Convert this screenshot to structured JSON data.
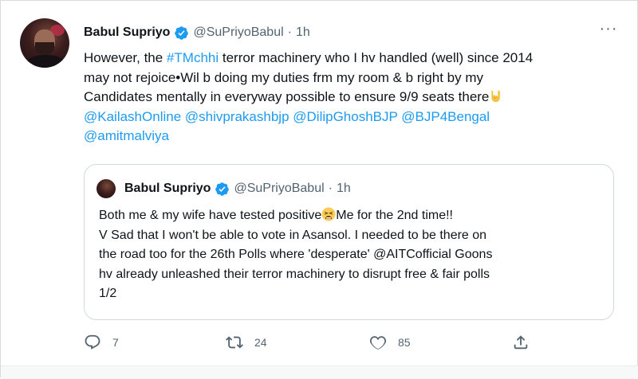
{
  "tweet": {
    "author_name": "Babul Supriyo",
    "handle": "@SuPriyoBabul",
    "separator": "·",
    "time": "1h",
    "more_label": "···",
    "lines": [
      [
        "However, the ",
        "#TMchhi",
        " terror machinery who I hv handled (well) since 2014"
      ],
      "may not rejoice•Wil b doing my duties frm my room & b right by my",
      "Candidates mentally in everyway possible to ensure 9/9 seats there",
      "@KailashOnline @shivprakashbjp @DilipGhoshBJP @BJP4Bengal",
      "@amitmalviya"
    ]
  },
  "quoted": {
    "author_name": "Babul Supriyo",
    "handle": "@SuPriyoBabul",
    "separator": "·",
    "time": "1h",
    "lines": [
      [
        "Both me & my wife have tested positive",
        "Me for the 2nd time!!"
      ],
      "V Sad that I won't be able to vote in Asansol. I needed to be there on",
      [
        "the road too for the 26th Polls where 'desperate' ",
        "@AITCofficial",
        " Goons"
      ],
      "hv already unleashed their terror machinery to disrupt free & fair polls",
      "1/2"
    ]
  },
  "actions": {
    "reply_count": "7",
    "retweet_count": "24",
    "like_count": "85"
  },
  "icons": {
    "verified": "verified-badge-icon",
    "reply": "reply-icon",
    "retweet": "retweet-icon",
    "like": "heart-icon",
    "share": "share-icon",
    "rock_emoji": "sign-of-horns-emoji-icon",
    "tired_emoji": "tired-face-emoji-icon"
  },
  "colors": {
    "link": "#1d9bf0",
    "verified": "#1d9bf0",
    "muted": "#536471"
  }
}
